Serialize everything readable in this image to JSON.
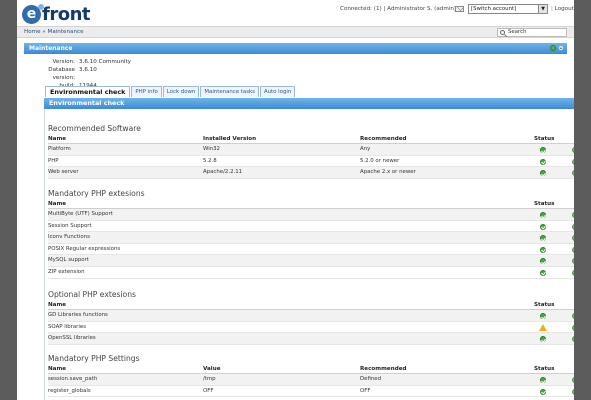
{
  "header": {
    "logo_text": "front",
    "connected_text": "Connected: (1) | Administrator S. (admin) |",
    "switch_account": "[Switch account]",
    "logout": "Logout"
  },
  "breadcrumb": "Home » Maintenance",
  "search_placeholder": "Search",
  "maintenance": {
    "title": "Maintenance",
    "versions": [
      {
        "label": "Version:",
        "value": "3.6.10 Community"
      },
      {
        "label": "Database version:",
        "value": "3.6.10"
      },
      {
        "label": "build:",
        "value": "11944"
      }
    ]
  },
  "tabs": [
    "Environmental check",
    "PHP info",
    "Lock down",
    "Maintenance tasks",
    "Auto login"
  ],
  "env_title": "Environmental check",
  "recommended_software": {
    "title": "Recommended Software",
    "headers": [
      "Name",
      "Installed Version",
      "Recommended",
      "Status"
    ],
    "rows": [
      {
        "name": "Platform",
        "installed": "Win32",
        "recommended": "Any",
        "status": "ok"
      },
      {
        "name": "PHP",
        "installed": "5.2.8",
        "recommended": "5.2.0 or newer",
        "status": "ok"
      },
      {
        "name": "Web server",
        "installed": "Apache/2.2.11",
        "recommended": "Apache 2.x or newer",
        "status": "ok"
      }
    ]
  },
  "mandatory_ext": {
    "title": "Mandatory PHP extesions",
    "headers": [
      "Name",
      "Status"
    ],
    "rows": [
      {
        "name": "MultiByte (UTF) Support",
        "status": "ok"
      },
      {
        "name": "Session Support",
        "status": "ok"
      },
      {
        "name": "Iconv Functions",
        "status": "ok"
      },
      {
        "name": "POSIX Regular expressions",
        "status": "ok"
      },
      {
        "name": "MySQL support",
        "status": "ok"
      },
      {
        "name": "ZIP extension",
        "status": "ok"
      }
    ]
  },
  "optional_ext": {
    "title": "Optional PHP extesions",
    "headers": [
      "Name",
      "Status"
    ],
    "rows": [
      {
        "name": "GD Libraries functions",
        "status": "ok"
      },
      {
        "name": "SOAP libraries",
        "status": "warning"
      },
      {
        "name": "OpenSSL libraries",
        "status": "ok"
      }
    ]
  },
  "mandatory_settings": {
    "title": "Mandatory PHP Settings",
    "headers": [
      "Name",
      "Value",
      "Recommended",
      "Status"
    ],
    "rows": [
      {
        "name": "session.save_path",
        "value": "/tmp",
        "recommended": "Defined",
        "status": "ok"
      },
      {
        "name": "register_globals",
        "value": "OFF",
        "recommended": "OFF",
        "status": "ok"
      }
    ]
  },
  "colors": {
    "header_blue": "#3d8ad3",
    "status_ok": "#3fae3a",
    "status_warning": "#e8b21c",
    "background": "#5c5c5c"
  }
}
